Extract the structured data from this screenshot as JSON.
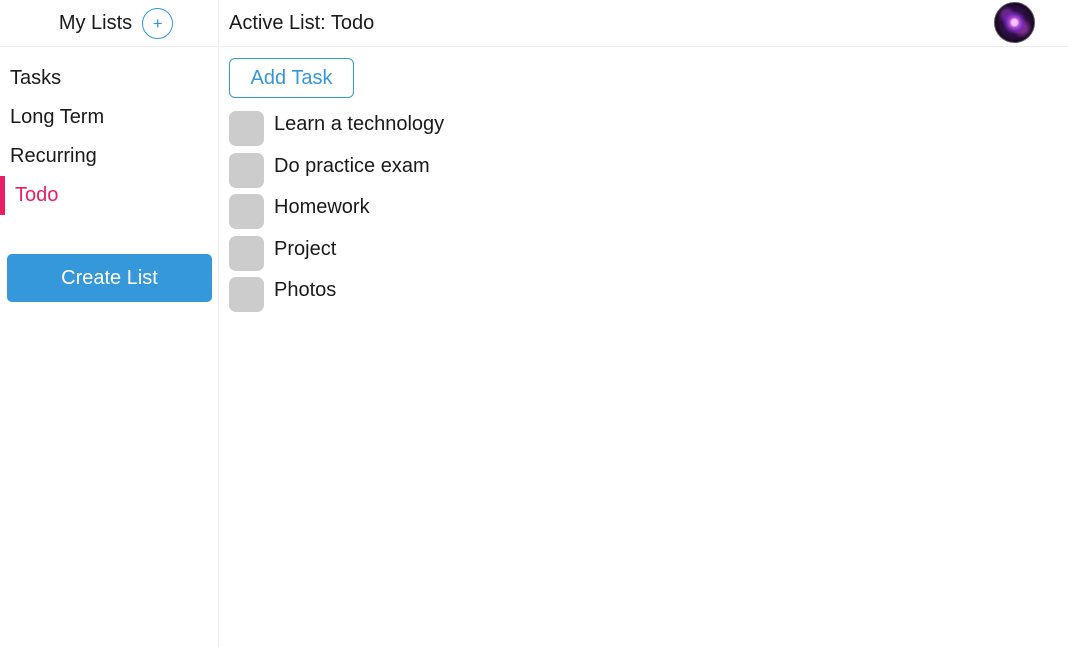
{
  "sidebar": {
    "title": "My Lists",
    "add_icon": "+",
    "items": [
      {
        "label": "Tasks",
        "active": false
      },
      {
        "label": "Long Term",
        "active": false
      },
      {
        "label": "Recurring",
        "active": false
      },
      {
        "label": "Todo",
        "active": true
      }
    ],
    "create_list_label": "Create List"
  },
  "header": {
    "active_list_prefix": "Active List:",
    "active_list_name": "Todo",
    "avatar": "user-avatar"
  },
  "main": {
    "add_task_label": "Add Task",
    "tasks": [
      {
        "label": "Learn a technology",
        "done": false
      },
      {
        "label": "Do practice exam",
        "done": false
      },
      {
        "label": "Homework",
        "done": false
      },
      {
        "label": "Project",
        "done": false
      },
      {
        "label": "Photos",
        "done": false
      }
    ]
  },
  "colors": {
    "accent_blue": "#3498db",
    "active_pink": "#e91e63",
    "checkbox_grey": "#cccccc"
  }
}
